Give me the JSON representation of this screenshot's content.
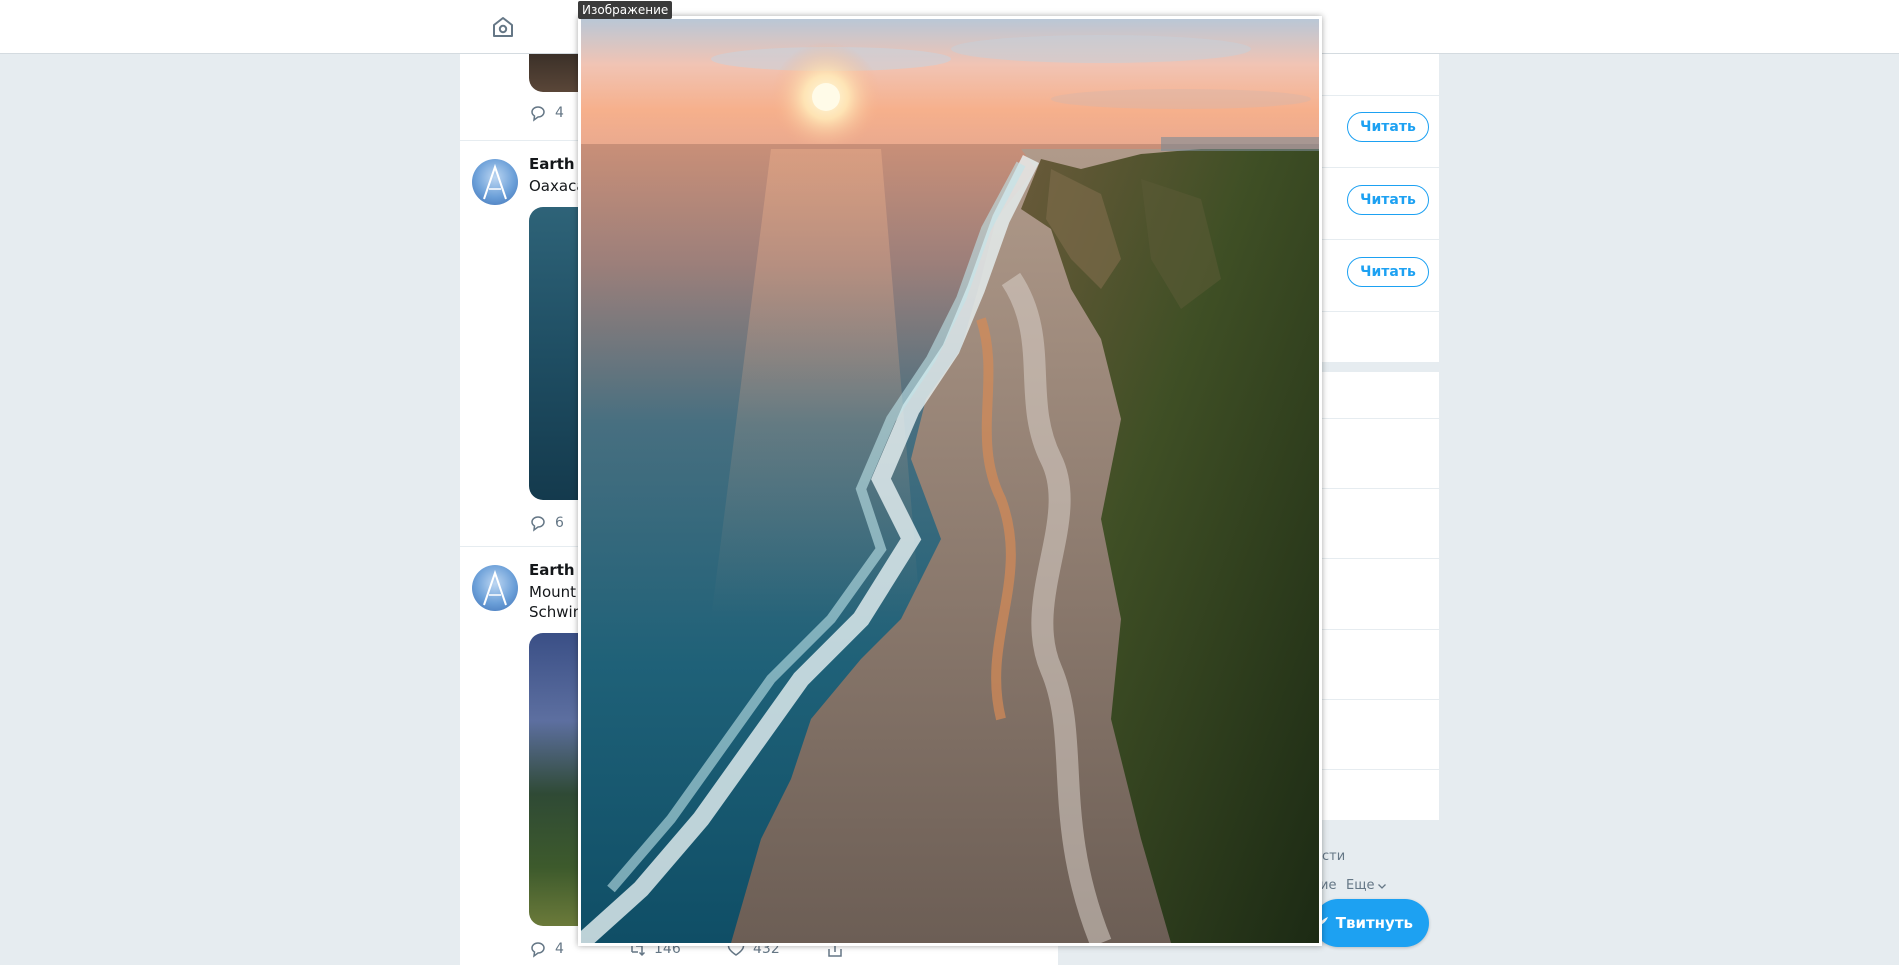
{
  "viewer": {
    "label": "Изображение"
  },
  "feed": {
    "tweets": [
      {
        "name": "",
        "text": "",
        "replies": "4"
      },
      {
        "name": "Earth P",
        "text": "Oaxaca,",
        "replies": "6"
      },
      {
        "name": "Earth P",
        "text_line1": "Mount F",
        "text_line2": "Schwinc",
        "replies": "4",
        "retweets": "146",
        "likes": "432"
      }
    ]
  },
  "sidebar": {
    "follow_label": "Читать",
    "footer_link1": "сти",
    "footer_link2": "ие",
    "more_label": "Еще",
    "tweet_button_label": "Твитнуть"
  },
  "colors": {
    "accent": "#1da1f2",
    "background": "#e6ecf0",
    "muted": "#657786"
  },
  "icons": [
    "home-icon",
    "reply-icon",
    "retweet-icon",
    "like-icon",
    "share-icon",
    "compose-icon",
    "chevron-down-icon"
  ]
}
